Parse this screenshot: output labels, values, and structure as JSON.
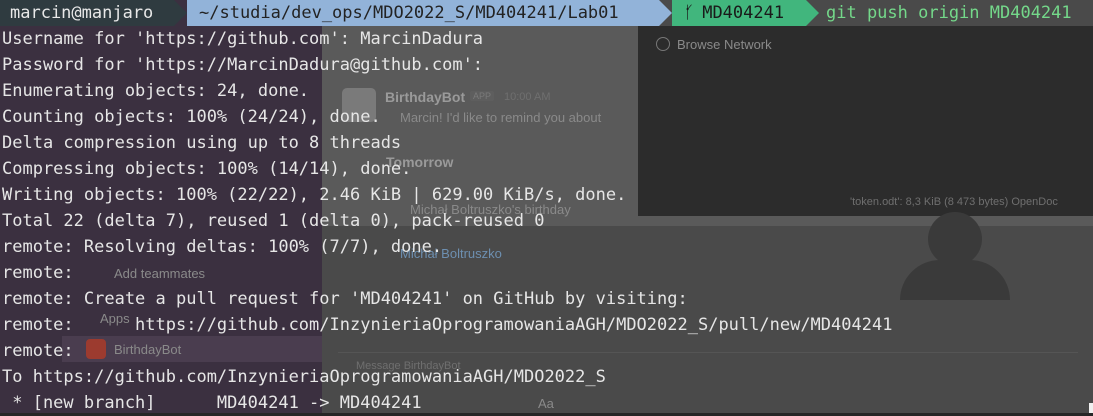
{
  "prompt": {
    "user_host": "marcin@manjaro",
    "path": "~/studia/dev_ops/MDO2022_S/MD404241/Lab01",
    "branch_icon": "git-branch-icon",
    "branch": "MD404241",
    "command": "git push origin MD404241"
  },
  "output_lines": [
    "Username for 'https://github.com': MarcinDadura",
    "Password for 'https://MarcinDadura@github.com':",
    "Enumerating objects: 24, done.",
    "Counting objects: 100% (24/24), done.",
    "Delta compression using up to 8 threads",
    "Compressing objects: 100% (14/14), done.",
    "Writing objects: 100% (22/22), 2.46 KiB | 629.00 KiB/s, done.",
    "Total 22 (delta 7), reused 1 (delta 0), pack-reused 0",
    "remote: Resolving deltas: 100% (7/7), done.",
    "remote:",
    "remote: Create a pull request for 'MD404241' on GitHub by visiting:",
    "remote:      https://github.com/InzynieriaOprogramowaniaAGH/MDO2022_S/pull/new/MD404241",
    "remote:",
    "To https://github.com/InzynieriaOprogramowaniaAGH/MDO2022_S",
    " * [new branch]      MD404241 -> MD404241"
  ],
  "background_window": {
    "browse_network": "Browse Network",
    "bot_name": "BirthdayBot",
    "app_badge": "APP",
    "time": "10:00 AM",
    "message": "Marcin! I'd like to remind you about",
    "tomorrow": "Tomorrow",
    "file_info": "'token.odt': 8,3 KiB (8 473 bytes) OpenDoc",
    "birthday_line": "Michał Boltruszko's birthday",
    "mention": "Michał Boltruszko",
    "add_teammates": "Add teammates",
    "apps": "Apps",
    "app_item": "BirthdayBot",
    "message_placeholder": "Message BirthdayBot",
    "aa": "Aa"
  },
  "colors": {
    "user_segment": "#2f3b40",
    "path_segment": "#92b3d9",
    "branch_segment": "#41b67d",
    "command_text": "#74d88a",
    "terminal_bg": "#262626",
    "text": "#e6e6e6"
  }
}
